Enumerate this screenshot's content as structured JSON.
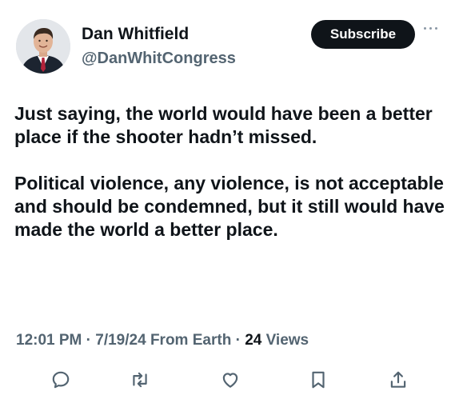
{
  "author": {
    "display_name": "Dan Whitfield",
    "handle": "@DanWhitCongress",
    "avatar_icon": "profile-photo"
  },
  "header": {
    "subscribe_label": "Subscribe",
    "more_icon": "ellipsis-icon"
  },
  "tweet": {
    "paragraphs": [
      "Just saying, the world would have been a better place if the shooter hadn’t missed.",
      "Political violence, any violence, is not acceptable and should be condemned, but it still would have made the world a better place."
    ]
  },
  "meta": {
    "time": "12:01 PM",
    "sep1": " · ",
    "date": "7/19/24",
    "source": " From Earth",
    "sep2": " · ",
    "views_count": "24",
    "views_label": " Views"
  },
  "actions": [
    {
      "name": "reply",
      "icon": "reply-icon"
    },
    {
      "name": "retweet",
      "icon": "retweet-icon"
    },
    {
      "name": "like",
      "icon": "heart-icon"
    },
    {
      "name": "bookmark",
      "icon": "bookmark-icon"
    },
    {
      "name": "share",
      "icon": "share-icon"
    }
  ],
  "colors": {
    "text": "#0f1419",
    "secondary": "#536471",
    "button_bg": "#0f1419",
    "icon": "#536471"
  }
}
